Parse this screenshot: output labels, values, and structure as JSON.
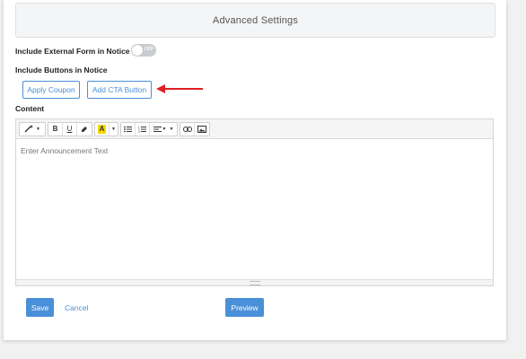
{
  "advanced_settings": {
    "title": "Advanced Settings"
  },
  "external_form": {
    "label": "Include External Form in Notice",
    "toggle_state": "OFF"
  },
  "buttons_section": {
    "label": "Include Buttons in Notice",
    "apply_coupon": "Apply Coupon",
    "add_cta": "Add CTA Button"
  },
  "content": {
    "label": "Content",
    "placeholder": "Enter Announcement Text",
    "toolbar": {
      "style_icon": "magic-wand-icon",
      "bold": "B",
      "underline": "U",
      "eraser_icon": "eraser-icon",
      "highlight": "A",
      "list_unordered_icon": "unordered-list-icon",
      "list_ordered_icon": "ordered-list-icon",
      "align_icon": "align-icon",
      "link_icon": "link-icon",
      "image_icon": "image-icon"
    }
  },
  "footer": {
    "save": "Save",
    "cancel": "Cancel",
    "preview": "Preview"
  },
  "colors": {
    "accent": "#4a90d9",
    "arrow": "#e02020",
    "highlight": "#f5d900"
  }
}
